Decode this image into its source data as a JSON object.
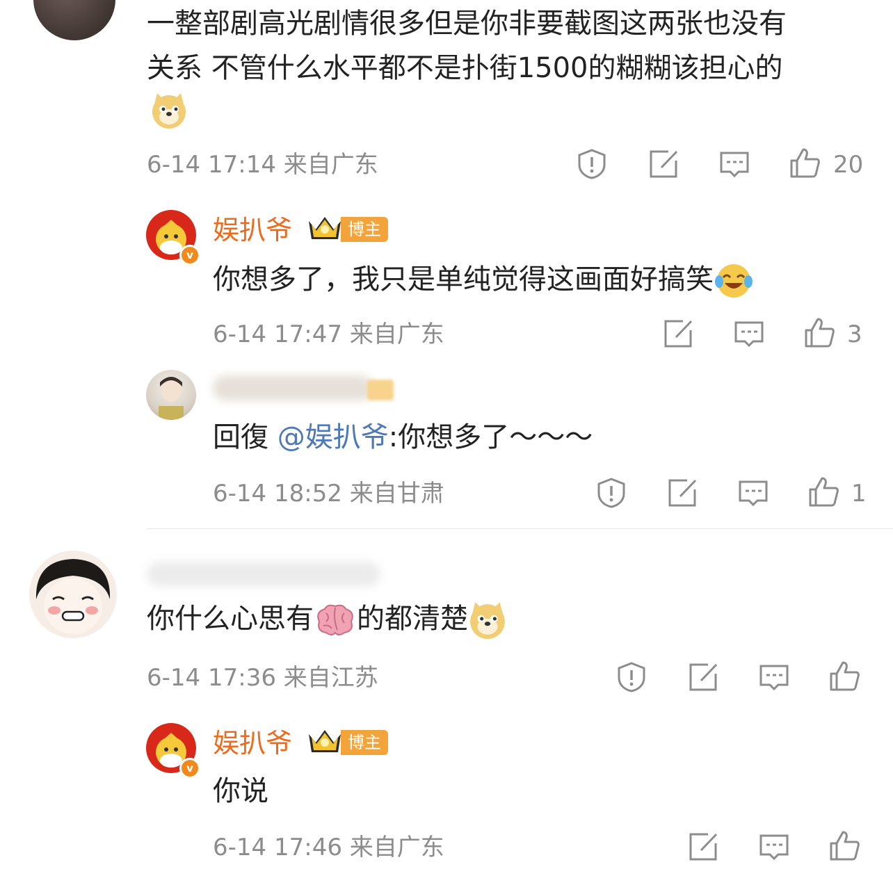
{
  "comments": [
    {
      "text_line1": "一整部剧高光剧情很多但是你非要截图这两张也没有",
      "text_line2": "关系 不管什么水平都不是扑街1500的糊糊该担心的",
      "emoji": "doge-emoji",
      "time_location": "6-14 17:14  来自广东",
      "likes": "20",
      "replies": [
        {
          "author": "娱扒爷",
          "badge": "博主",
          "text": "你想多了，我只是单纯觉得这画面好搞笑",
          "emoji": "laughing-crying-emoji",
          "time_location": "6-14 17:47  来自广东",
          "likes": "3"
        },
        {
          "reply_prefix": "回復",
          "mention": "@娱扒爷",
          "text": ":你想多了～～～",
          "time_location": "6-14 18:52  来自甘肃",
          "likes": "1"
        }
      ]
    },
    {
      "text": "你什么心思有",
      "text_after": "的都清楚",
      "emoji_mid": "brain-emoji",
      "emoji_end": "doge-emoji",
      "time_location": "6-14 17:36  来自江苏",
      "replies": [
        {
          "author": "娱扒爷",
          "badge": "博主",
          "text": "你说",
          "time_location": "6-14 17:46  来自广东"
        }
      ]
    }
  ],
  "colors": {
    "name": "#ee6b1e",
    "mention": "#4e79b6",
    "meta": "#8c8c8c",
    "badge": "#f2a33a"
  }
}
